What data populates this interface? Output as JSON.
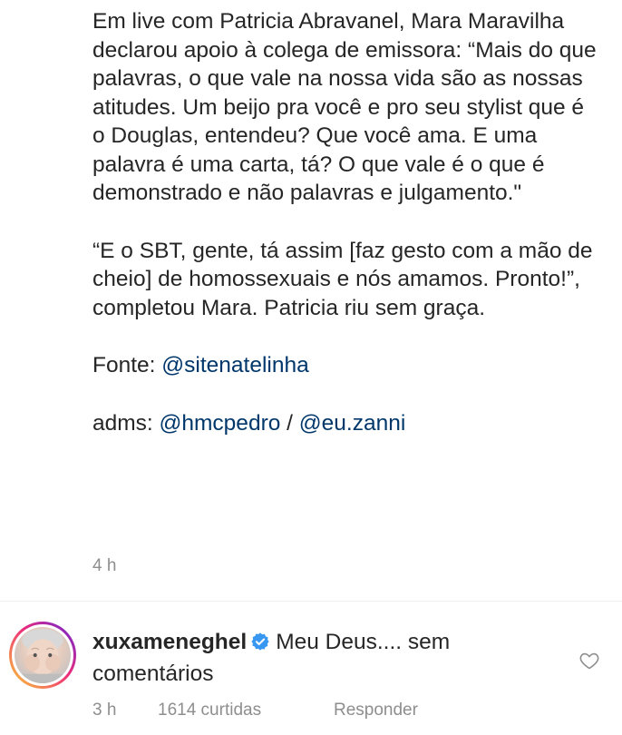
{
  "caption": {
    "paragraph1": "Em live com Patricia Abravanel, Mara Maravilha declarou apoio à colega de emissora: “Mais do que palavras, o que vale na nossa vida são as nossas atitudes. Um beijo pra você e pro seu stylist que é o Douglas, entendeu? Que você ama. E uma palavra é uma carta, tá? O que vale é o que é demonstrado e não palavras e julgamento.\"",
    "paragraph2": "“E o SBT, gente, tá assim [faz gesto com a mão de cheio] de homossexuais e nós amamos. Pronto!”, completou Mara. Patricia riu sem graça.",
    "source_label": "Fonte: ",
    "source_mention": "@sitenatelinha",
    "admins_label": "adms: ",
    "admin_mention_1": "@hmcpedro",
    "admins_separator": " / ",
    "admin_mention_2": "@eu.zanni",
    "time": "4 h"
  },
  "comment": {
    "username": "xuxameneghel",
    "text": "Meu Deus.... sem comentários",
    "time": "3 h",
    "likes": "1614 curtidas",
    "reply_label": "Responder"
  },
  "icons": {
    "verified": "verified-badge-icon",
    "like": "heart-outline-icon"
  },
  "colors": {
    "text": "#262626",
    "mention": "#00376b",
    "muted": "#8e8e8e",
    "verified": "#3897f0"
  }
}
